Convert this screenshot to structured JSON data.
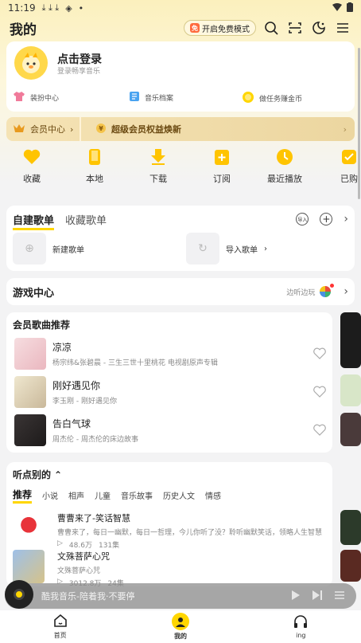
{
  "status": {
    "time": "11:19",
    "extra": "•"
  },
  "header": {
    "title": "我的",
    "free_mode": "开启免费模式",
    "free_icon": "免"
  },
  "login": {
    "title": "点击登录",
    "subtitle": "登录畅享音乐",
    "links": [
      "装扮中心",
      "音乐档案",
      "做任务赚金币"
    ]
  },
  "vip": {
    "center": "会员中心",
    "upgrade": "超级会员权益焕新"
  },
  "quick": [
    "收藏",
    "本地",
    "下载",
    "订阅",
    "最近播放",
    "已购"
  ],
  "playlists": {
    "tabs": [
      "自建歌单",
      "收藏歌单"
    ],
    "new": "新建歌单",
    "import": "导入歌单",
    "import_icon_label": "导入"
  },
  "game": {
    "title": "游戏中心",
    "hint": "边听边玩"
  },
  "vip_songs": {
    "title": "会员歌曲推荐",
    "songs": [
      {
        "title": "凉凉",
        "subtitle": "杨宗纬&张碧晨 - 三生三世十里桃花 电视剧原声专辑",
        "cover": "#f2d4d8"
      },
      {
        "title": "刚好遇见你",
        "subtitle": "李玉刚 - 刚好遇见你",
        "cover": "#e7dfc6"
      },
      {
        "title": "告白气球",
        "subtitle": "周杰伦 - 周杰伦的床边故事",
        "cover": "#2e2a2a"
      }
    ]
  },
  "listen": {
    "title": "听点别的",
    "tabs": [
      "推荐",
      "小说",
      "相声",
      "儿童",
      "音乐故事",
      "历史人文",
      "情感"
    ],
    "items": [
      {
        "title": "曹曹来了-笑话智慧",
        "subtitle": "曹曹来了，每日一幽默，每日一哲理，今儿你听了没？聆听幽默笑话，领略人生智慧",
        "plays": "48.6万",
        "episodes": "131集"
      },
      {
        "title": "文殊菩萨心咒",
        "subtitle": "文殊菩萨心咒",
        "plays": "3012.8万",
        "episodes": "24集"
      }
    ]
  },
  "player": {
    "text": "酷我音乐-陪着我·不要停"
  },
  "nav": [
    "首页",
    "我的",
    "ing"
  ],
  "colors": {
    "accent": "#ffd600",
    "vip_gold": "#ecd6a0"
  }
}
